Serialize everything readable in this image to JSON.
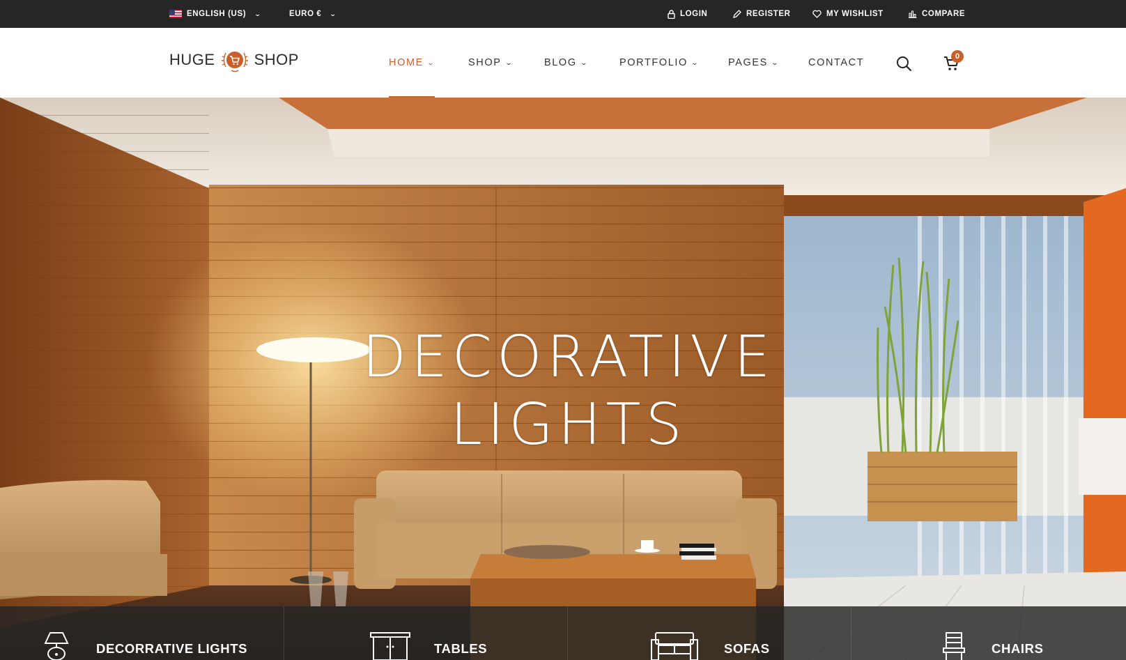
{
  "topbar": {
    "language": "ENGLISH (US)",
    "currency": "EURO €",
    "login": "LOGIN",
    "register": "REGISTER",
    "wishlist": "MY WISHLIST",
    "compare": "COMPARE"
  },
  "logo": {
    "left": "HUGE",
    "right": "SHOP"
  },
  "nav": {
    "home": "HOME",
    "shop": "SHOP",
    "blog": "BLOG",
    "portfolio": "PORTFOLIO",
    "pages": "PAGES",
    "contact": "CONTACT",
    "cart_count": "0"
  },
  "hero": {
    "line1": "DECORATIVE",
    "line2": "LIGHTS"
  },
  "categories": [
    {
      "label": "DECORRATIVE LIGHTS",
      "icon": "lamp-icon"
    },
    {
      "label": "TABLES",
      "icon": "table-icon"
    },
    {
      "label": "SOFAS",
      "icon": "sofa-icon"
    },
    {
      "label": "CHAIRS",
      "icon": "chair-icon"
    }
  ],
  "colors": {
    "accent": "#c9602a",
    "topbar_bg": "#262626",
    "header_bg": "#ffffff",
    "nav_text": "#333333",
    "category_bar_bg": "#262626"
  }
}
